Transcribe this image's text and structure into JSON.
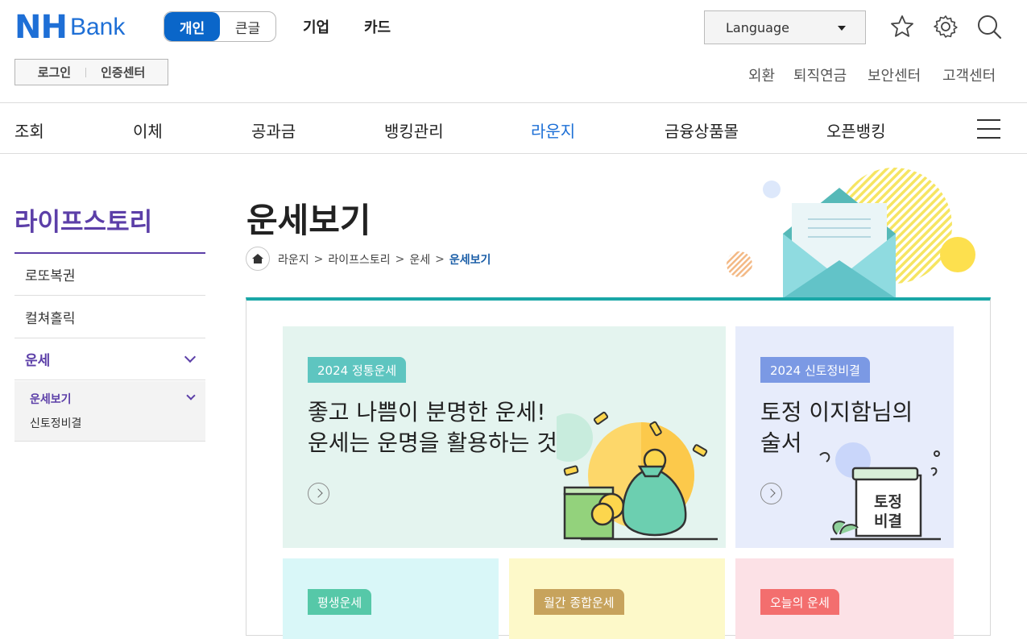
{
  "header": {
    "logo": {
      "nh": "NH",
      "bank": "Bank"
    },
    "mode": {
      "personal": "개인",
      "large_text": "큰글"
    },
    "top_links": [
      "기업",
      "카드"
    ],
    "language": "Language",
    "login": "로그인",
    "cert_center": "인증센터",
    "util_links": [
      "외환",
      "퇴직연금",
      "보안센터",
      "고객센터"
    ],
    "icons": [
      "star-icon",
      "gear-icon",
      "search-icon"
    ]
  },
  "gnb": {
    "items": [
      "조회",
      "이체",
      "공과금",
      "뱅킹관리",
      "라운지",
      "금융상품몰",
      "오픈뱅킹"
    ],
    "active": "라운지"
  },
  "lnb": {
    "title": "라이프스토리",
    "items": [
      "로또복권",
      "컬쳐홀릭",
      "운세"
    ],
    "sub_items": [
      "운세보기",
      "신토정비결"
    ]
  },
  "content": {
    "title": "운세보기",
    "breadcrumb": [
      "라운지",
      "라이프스토리",
      "운세",
      "운세보기"
    ],
    "cards": [
      {
        "tag": "2024 정통운세",
        "line1": "좋고 나쁨이 분명한 운세!",
        "line2": "운세는 운명을 활용하는 것"
      },
      {
        "tag": "2024 신토정비결",
        "line1": "토정 이지함님의",
        "line2": "술서",
        "book_line1": "토정",
        "book_line2": "비결"
      },
      {
        "tag": "평생운세"
      },
      {
        "tag": "월간 종합운세"
      },
      {
        "tag": "오늘의 운세"
      }
    ]
  },
  "colors": {
    "brand": "#1e6fd6",
    "lnb_accent": "#5c3fa8",
    "panel_top": "#1aa7a7"
  }
}
